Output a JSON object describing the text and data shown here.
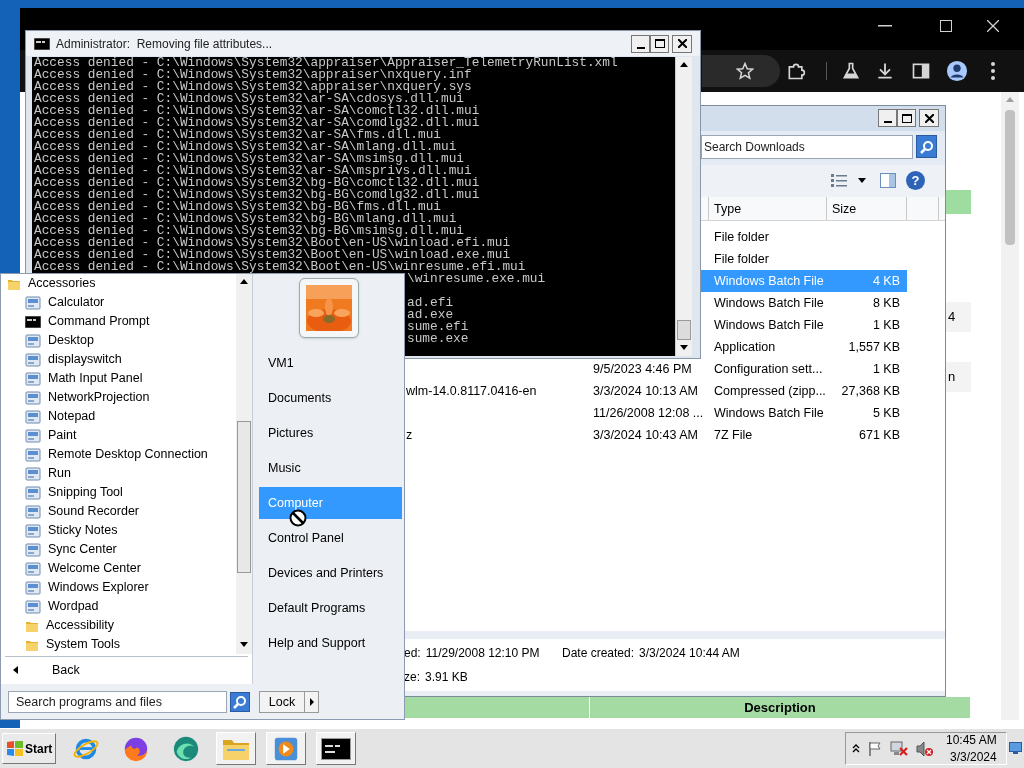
{
  "browser_window": {
    "page": {
      "cells": [
        {
          "text": "4"
        },
        {
          "text": "n"
        }
      ],
      "bottom_header": "Description"
    }
  },
  "explorer_window": {
    "search": {
      "placeholder": "Search Downloads"
    },
    "help_button": "?",
    "columns": [
      "Type",
      "Size"
    ],
    "rows": [
      {
        "type": "File folder",
        "selected": false
      },
      {
        "type": "File folder",
        "selected": false
      },
      {
        "type": "Windows Batch File",
        "size": "4 KB",
        "selected": true
      },
      {
        "type": "Windows Batch File",
        "size": "8 KB",
        "selected": false
      },
      {
        "type": "Windows Batch File",
        "size": "1 KB",
        "selected": false
      },
      {
        "type": "Application",
        "size": "1,557 KB",
        "selected": false
      },
      {
        "date_modified": "9/5/2023 4:46 PM",
        "type": "Configuration sett...",
        "size": "1 KB",
        "selected": false
      },
      {
        "name": "wlm-14.0.8117.0416-en",
        "date_modified": "3/3/2024 10:13 AM",
        "type": "Compressed (zipp...",
        "size": "27,368 KB",
        "selected": false
      },
      {
        "date_modified": "11/26/2008 12:08 ...",
        "type": "Windows Batch File",
        "size": "5 KB",
        "selected": false
      },
      {
        "name": "z",
        "date_modified": "3/3/2024 10:43 AM",
        "type": "7Z File",
        "size": "671 KB",
        "selected": false
      }
    ],
    "details": [
      {
        "label": "ed:",
        "value": "11/29/2008 12:10 PM"
      },
      {
        "label": "Date created:",
        "value": "3/3/2024 10:44 AM"
      },
      {
        "label": "ze:",
        "value": "3.91 KB"
      }
    ]
  },
  "console_window": {
    "title": "Administrator:  Removing file attributes...",
    "lines": [
      "Access denied - C:\\Windows\\System32\\appraiser\\Appraiser_TelemetryRunList.xml",
      "Access denied - C:\\Windows\\System32\\appraiser\\nxquery.inf",
      "Access denied - C:\\Windows\\System32\\appraiser\\nxquery.sys",
      "Access denied - C:\\Windows\\System32\\ar-SA\\cdosys.dll.mui",
      "Access denied - C:\\Windows\\System32\\ar-SA\\comctl32.dll.mui",
      "Access denied - C:\\Windows\\System32\\ar-SA\\comdlg32.dll.mui",
      "Access denied - C:\\Windows\\System32\\ar-SA\\fms.dll.mui",
      "Access denied - C:\\Windows\\System32\\ar-SA\\mlang.dll.mui",
      "Access denied - C:\\Windows\\System32\\ar-SA\\msimsg.dll.mui",
      "Access denied - C:\\Windows\\System32\\ar-SA\\msprivs.dll.mui",
      "Access denied - C:\\Windows\\System32\\bg-BG\\comctl32.dll.mui",
      "Access denied - C:\\Windows\\System32\\bg-BG\\comdlg32.dll.mui",
      "Access denied - C:\\Windows\\System32\\bg-BG\\fms.dll.mui",
      "Access denied - C:\\Windows\\System32\\bg-BG\\mlang.dll.mui",
      "Access denied - C:\\Windows\\System32\\bg-BG\\msimsg.dll.mui",
      "Access denied - C:\\Windows\\System32\\Boot\\en-US\\winload.efi.mui",
      "Access denied - C:\\Windows\\System32\\Boot\\en-US\\winload.exe.mui",
      "Access denied - C:\\Windows\\System32\\Boot\\en-US\\winresume.efi.mui"
    ],
    "covered_lines": [
      "\\winresume.exe.mui",
      "ad.efi",
      "ad.exe",
      "sume.efi",
      "sume.exe"
    ]
  },
  "start_menu": {
    "programs": [
      {
        "label": "Accessories",
        "kind": "folder",
        "children": [
          {
            "label": "Calculator",
            "kind": "program"
          },
          {
            "label": "Command Prompt",
            "kind": "console"
          },
          {
            "label": "Desktop",
            "kind": "program"
          },
          {
            "label": "displayswitch",
            "kind": "program"
          },
          {
            "label": "Math Input Panel",
            "kind": "program"
          },
          {
            "label": "NetworkProjection",
            "kind": "program"
          },
          {
            "label": "Notepad",
            "kind": "program"
          },
          {
            "label": "Paint",
            "kind": "program"
          },
          {
            "label": "Remote Desktop Connection",
            "kind": "program"
          },
          {
            "label": "Run",
            "kind": "program"
          },
          {
            "label": "Snipping Tool",
            "kind": "program"
          },
          {
            "label": "Sound Recorder",
            "kind": "program"
          },
          {
            "label": "Sticky Notes",
            "kind": "program"
          },
          {
            "label": "Sync Center",
            "kind": "program"
          },
          {
            "label": "Welcome Center",
            "kind": "program"
          },
          {
            "label": "Windows Explorer",
            "kind": "program"
          },
          {
            "label": "Wordpad",
            "kind": "program"
          },
          {
            "label": "Accessibility",
            "kind": "folder"
          },
          {
            "label": "System Tools",
            "kind": "folder"
          }
        ]
      }
    ],
    "back": "Back",
    "search": {
      "placeholder": "Search programs and files"
    },
    "lock": "Lock",
    "places": [
      {
        "label": "VM1",
        "selected": false
      },
      {
        "label": "Documents",
        "selected": false
      },
      {
        "label": "Pictures",
        "selected": false
      },
      {
        "label": "Music",
        "selected": false
      },
      {
        "label": "Computer",
        "selected": true
      },
      {
        "label": "Control Panel",
        "selected": false
      },
      {
        "label": "Devices and Printers",
        "selected": false
      },
      {
        "label": "Default Programs",
        "selected": false
      },
      {
        "label": "Help and Support",
        "selected": false
      }
    ]
  },
  "taskbar": {
    "start": "Start",
    "apps": [
      {
        "kind": "globe",
        "open": false
      },
      {
        "kind": "flame",
        "open": false
      },
      {
        "kind": "swirl",
        "open": false
      },
      {
        "kind": "folder",
        "open": true
      },
      {
        "kind": "player",
        "open": true
      },
      {
        "kind": "console",
        "open": true
      }
    ],
    "clock": {
      "time": "10:45 AM",
      "date": "3/3/2024"
    }
  }
}
